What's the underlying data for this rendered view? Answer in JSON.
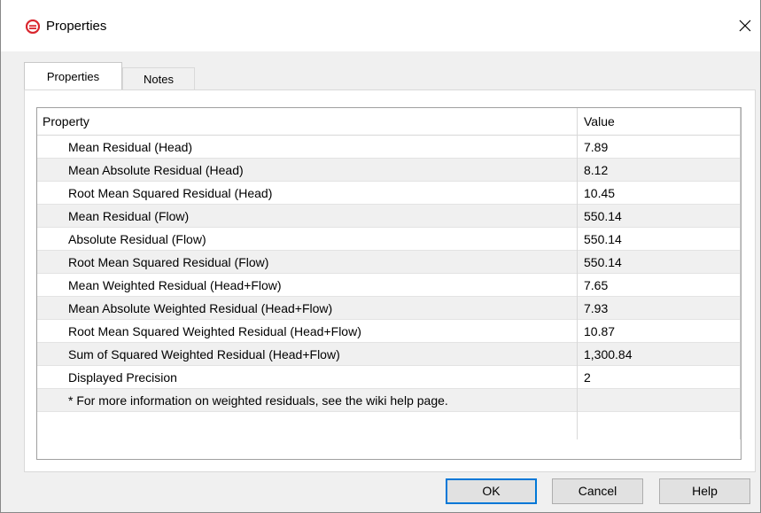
{
  "window": {
    "title": "Properties",
    "app_icon": "gms-logo-icon",
    "close_icon": "close-icon",
    "colors": {
      "icon_red": "#d9262e",
      "button_default_border": "#0078d7"
    }
  },
  "tabs": [
    {
      "label": "Properties",
      "active": true
    },
    {
      "label": "Notes",
      "active": false
    }
  ],
  "grid": {
    "columns": {
      "property": "Property",
      "value": "Value"
    },
    "rows": [
      {
        "property": "Mean Residual (Head)",
        "value": "7.89"
      },
      {
        "property": "Mean Absolute Residual (Head)",
        "value": "8.12"
      },
      {
        "property": "Root Mean Squared Residual (Head)",
        "value": "10.45"
      },
      {
        "property": "Mean Residual (Flow)",
        "value": "550.14"
      },
      {
        "property": "Absolute Residual (Flow)",
        "value": "550.14"
      },
      {
        "property": "Root Mean Squared Residual (Flow)",
        "value": "550.14"
      },
      {
        "property": "Mean Weighted Residual (Head+Flow)",
        "value": "7.65"
      },
      {
        "property": "Mean Absolute Weighted Residual (Head+Flow)",
        "value": "7.93"
      },
      {
        "property": "Root Mean Squared Weighted Residual (Head+Flow)",
        "value": "10.87"
      },
      {
        "property": "Sum of Squared Weighted Residual (Head+Flow)",
        "value": "1,300.84"
      },
      {
        "property": "Displayed Precision",
        "value": "2"
      },
      {
        "property": "* For more information on weighted residuals, see the wiki help page.",
        "value": ""
      }
    ]
  },
  "buttons": {
    "ok": "OK",
    "cancel": "Cancel",
    "help": "Help"
  }
}
